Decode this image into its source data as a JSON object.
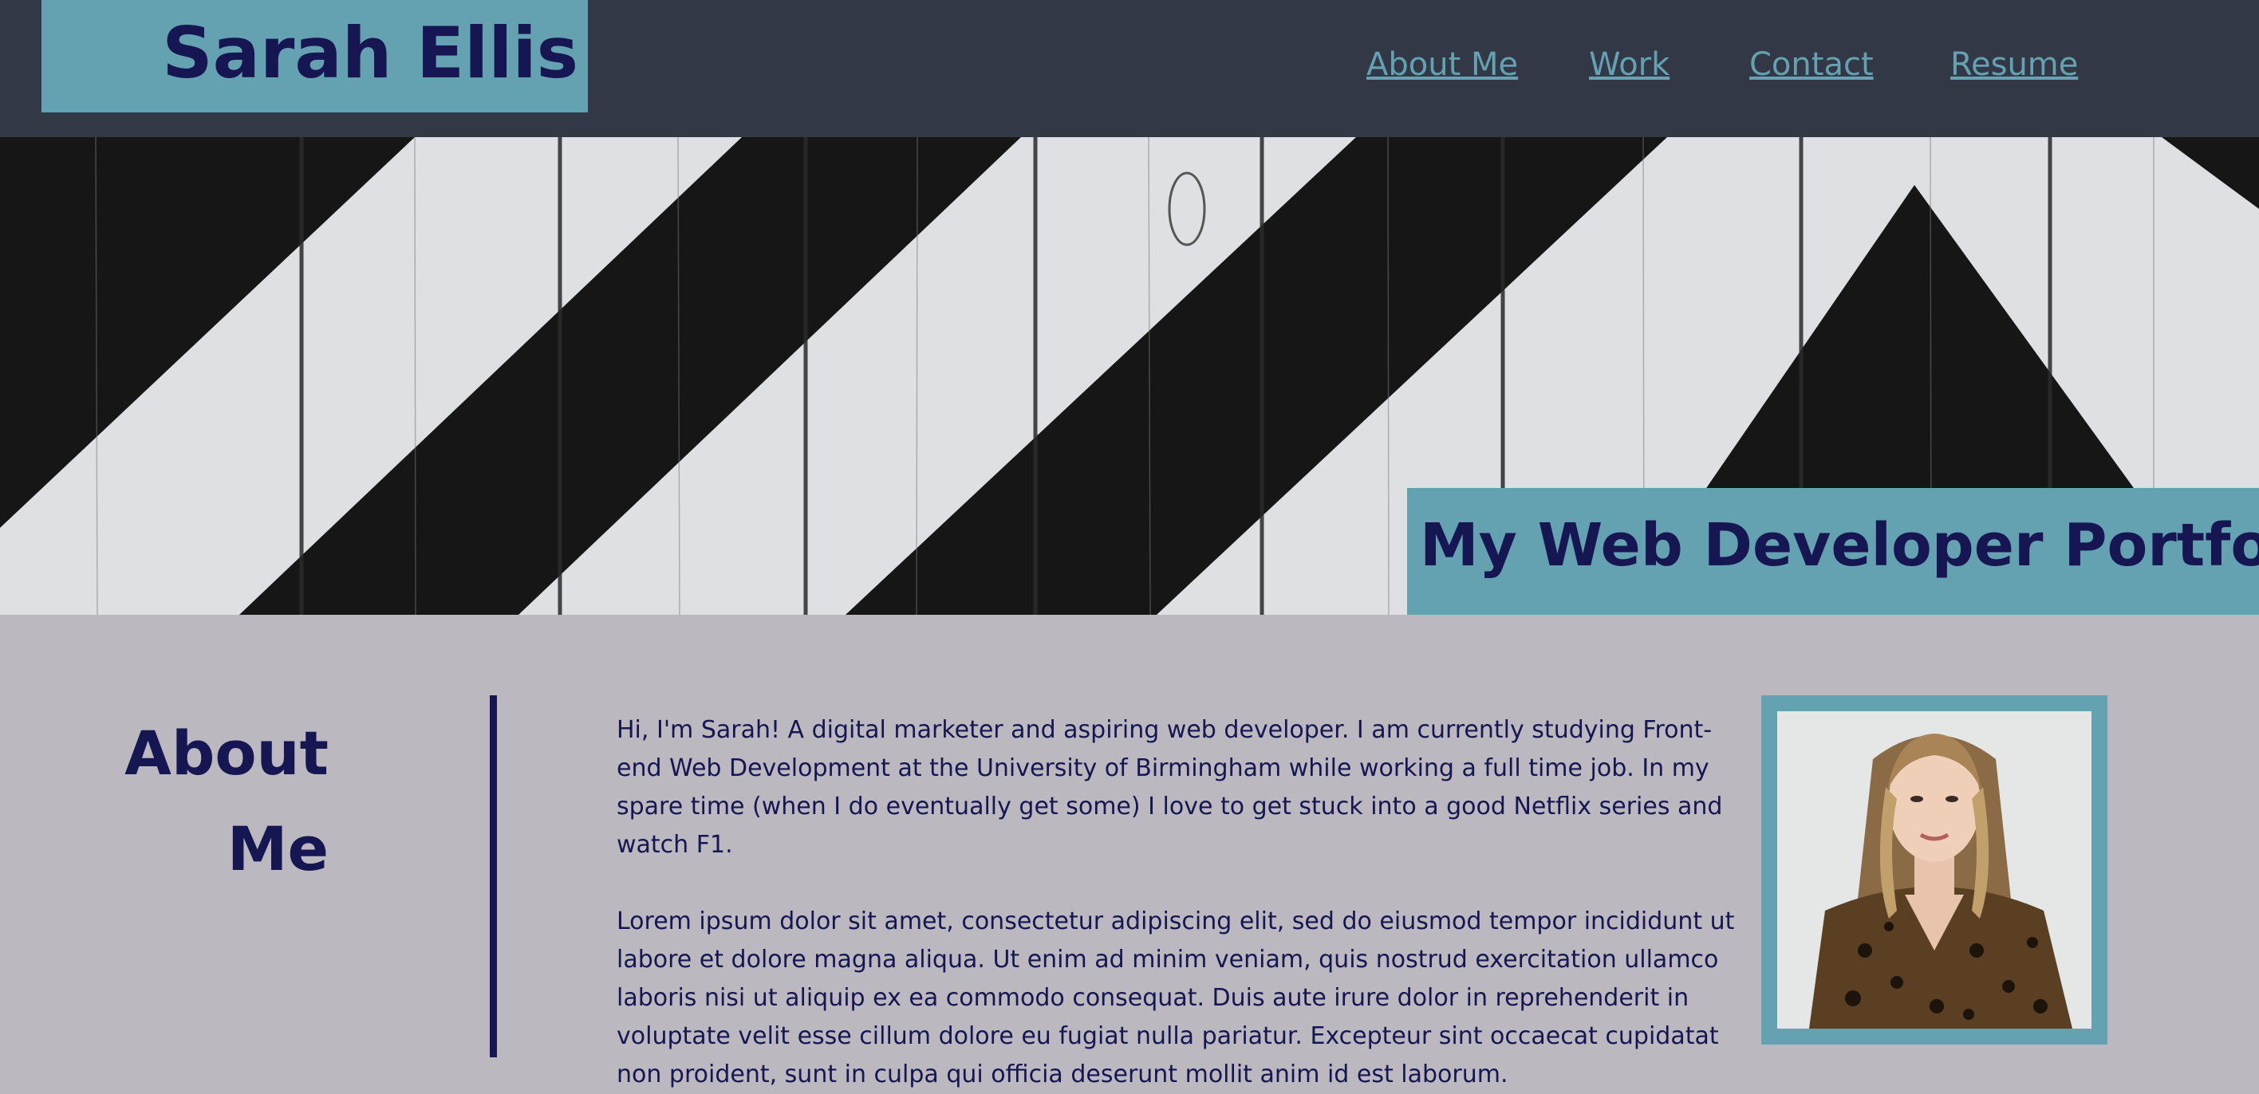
{
  "header": {
    "brand_name": "Sarah Ellis",
    "nav": [
      {
        "label": "About Me"
      },
      {
        "label": "Work"
      },
      {
        "label": "Contact"
      },
      {
        "label": "Resume"
      }
    ]
  },
  "hero": {
    "title": "My Web Developer Portfolio"
  },
  "about": {
    "heading_line1": "About",
    "heading_line2": "Me",
    "paragraphs": [
      "Hi, I'm Sarah! A digital marketer and aspiring web developer. I am currently studying Front-end Web Development at the University of Birmingham while working a full time job. In my spare time (when I do eventually get some) I love to get stuck into a good Netflix series and watch F1.",
      "Lorem ipsum dolor sit amet, consectetur adipiscing elit, sed do eiusmod tempor incididunt ut labore et dolore magna aliqua. Ut enim ad minim veniam, quis nostrud exercitation ullamco laboris nisi ut aliquip ex ea commodo consequat. Duis aute irure dolor in reprehenderit in voluptate velit esse cillum dolore eu fugiat nulla pariatur. Excepteur sint occaecat cupidatat non proident, sunt in culpa qui officia deserunt mollit anim id est laborum."
    ]
  },
  "colors": {
    "header_bg": "#323846",
    "accent_teal": "#64a1b1",
    "navy_text": "#151652",
    "page_bg": "#bbb8c0"
  },
  "icons": {
    "hero_image": "black-white-striped-wooden-planks",
    "profile_photo": "portrait-woman-leopard-blouse"
  }
}
